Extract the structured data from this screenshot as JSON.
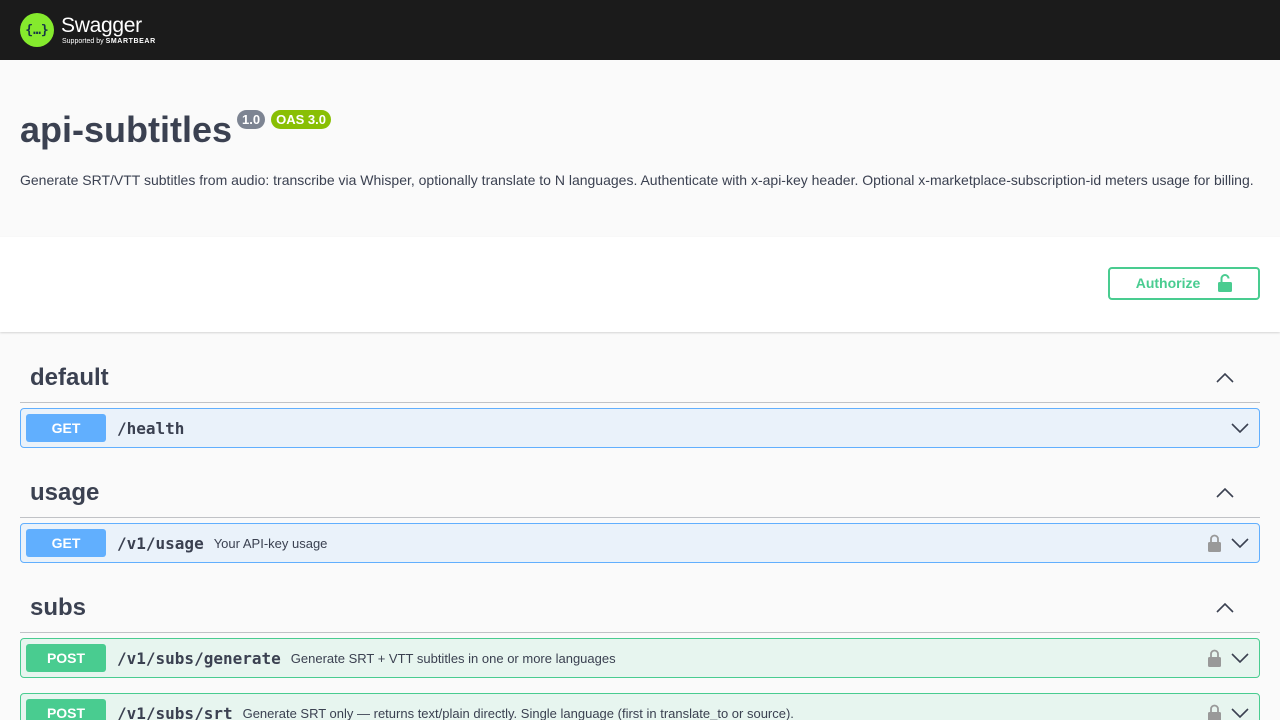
{
  "topbar": {
    "brand_name": "Swagger",
    "brand_tag_prefix": "Supported by",
    "brand_tag_company": "SMARTBEAR",
    "logo_glyph": "{…}"
  },
  "info": {
    "title": "api-subtitles",
    "version": "1.0",
    "oas": "OAS 3.0",
    "description": "Generate SRT/VTT subtitles from audio: transcribe via Whisper, optionally translate to N languages. Authenticate with x-api-key header. Optional x-marketplace-subscription-id meters usage for billing."
  },
  "authorize": {
    "label": "Authorize",
    "icon": "unlocked-icon"
  },
  "tags": [
    {
      "name": "default",
      "ops": [
        {
          "method": "GET",
          "path": "/health",
          "summary": "",
          "locked": false
        }
      ]
    },
    {
      "name": "usage",
      "ops": [
        {
          "method": "GET",
          "path": "/v1/usage",
          "summary": "Your API-key usage",
          "locked": true
        }
      ]
    },
    {
      "name": "subs",
      "ops": [
        {
          "method": "POST",
          "path": "/v1/subs/generate",
          "summary": "Generate SRT + VTT subtitles in one or more languages",
          "locked": true
        },
        {
          "method": "POST",
          "path": "/v1/subs/srt",
          "summary": "Generate SRT only — returns text/plain directly. Single language (first in translate_to or source).",
          "locked": true
        }
      ]
    }
  ],
  "colors": {
    "topbar": "#1b1b1b",
    "logo": "#85ea2d",
    "get": "#61affe",
    "post": "#49cc90",
    "text": "#3b4151",
    "badge_version": "#7d8492",
    "badge_oas": "#89bf04"
  }
}
